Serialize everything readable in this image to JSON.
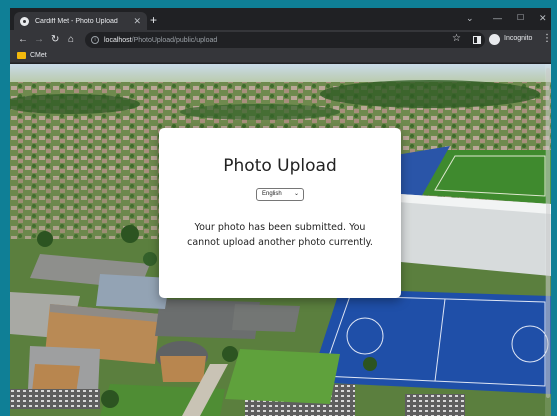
{
  "browser": {
    "tab": {
      "title": "Cardiff Met - Photo Upload",
      "close_icon": "close-icon",
      "favicon": "site-favicon"
    },
    "new_tab_label": "+",
    "window_controls": {
      "menu": "⌄",
      "minimize": "—",
      "maximize": "☐",
      "close": "✕"
    },
    "address_bar": {
      "host": "localhost",
      "path": "/PhotoUpload/public/upload"
    },
    "profile_label": "Incognito",
    "bookmarks": [
      {
        "label": "CMet"
      }
    ]
  },
  "page": {
    "title": "Photo Upload",
    "language": {
      "selected": "English"
    },
    "message": "Your photo has been submitted. You cannot upload another photo currently."
  },
  "colors": {
    "frame": "#202124",
    "toolbar": "#35363a",
    "card": "#ffffff",
    "outer_border": "#0f7f96",
    "pitch_blue": "#1f4fa8",
    "grass": "#4f8d34"
  }
}
